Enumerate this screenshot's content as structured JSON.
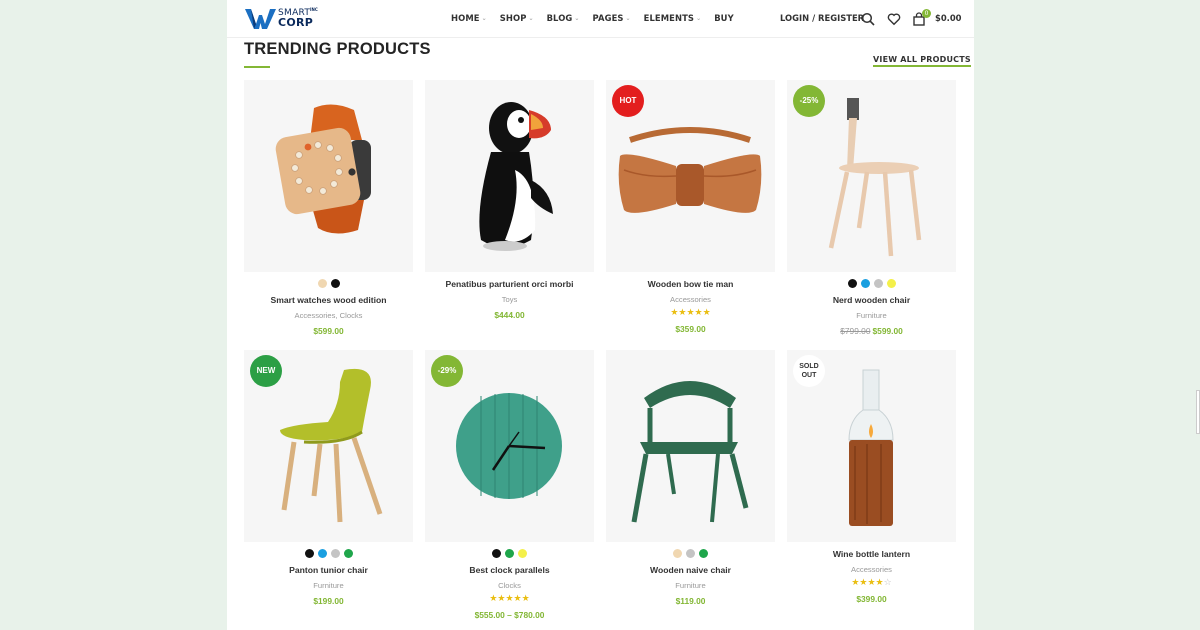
{
  "header": {
    "logo_line1": "SMART",
    "logo_line2": "CORP",
    "logo_mark": "INC",
    "nav": [
      {
        "label": "HOME",
        "caret": true
      },
      {
        "label": "SHOP",
        "caret": true
      },
      {
        "label": "BLOG",
        "caret": true
      },
      {
        "label": "PAGES",
        "caret": true
      },
      {
        "label": "ELEMENTS",
        "caret": true
      },
      {
        "label": "BUY",
        "caret": false
      }
    ],
    "login_label": "LOGIN / REGISTER",
    "cart_count": "0",
    "cart_total": "$0.00"
  },
  "section": {
    "title": "TRENDING PRODUCTS",
    "view_all": "VIEW ALL PRODUCTS"
  },
  "colors": {
    "accent": "#83b735",
    "hot": "#e31e1e",
    "new": "#2c9f45",
    "rating": "#eabe12"
  },
  "products": [
    {
      "name": "Smart watches wood edition",
      "category": "Accessories, Clocks",
      "price": "$599.00",
      "old_price": "",
      "badge": "",
      "rating": 0,
      "swatches": [
        "#f0d7b1",
        "#111111"
      ],
      "image": "watch"
    },
    {
      "name": "Penatibus parturient orci morbi",
      "category": "Toys",
      "price": "$444.00",
      "old_price": "",
      "badge": "",
      "rating": 0,
      "swatches": [],
      "image": "puffin"
    },
    {
      "name": "Wooden bow tie man",
      "category": "Accessories",
      "price": "$359.00",
      "old_price": "",
      "badge": "HOT",
      "rating": 5,
      "swatches": [],
      "image": "bowtie"
    },
    {
      "name": "Nerd wooden chair",
      "category": "Furniture",
      "price": "$599.00",
      "old_price": "$799.00",
      "badge": "-25%",
      "rating": 0,
      "swatches": [
        "#111111",
        "#1a9fe0",
        "#c4c4c4",
        "#f4f04a"
      ],
      "image": "chair"
    },
    {
      "name": "Panton tunior chair",
      "category": "Furniture",
      "price": "$199.00",
      "old_price": "",
      "badge": "NEW",
      "rating": 0,
      "swatches": [
        "#111111",
        "#1a9fe0",
        "#c4c4c4",
        "#1fa64b"
      ],
      "image": "panton"
    },
    {
      "name": "Best clock parallels",
      "category": "Clocks",
      "price": "$555.00 – $780.00",
      "old_price": "",
      "badge": "-29%",
      "rating": 5,
      "swatches": [
        "#111111",
        "#1fa64b",
        "#f4f04a"
      ],
      "image": "clock"
    },
    {
      "name": "Wooden naive chair",
      "category": "Furniture",
      "price": "$119.00",
      "old_price": "",
      "badge": "",
      "rating": 0,
      "swatches": [
        "#f0d7b1",
        "#c4c4c4",
        "#1fa64b"
      ],
      "image": "armchair"
    },
    {
      "name": "Wine bottle lantern",
      "category": "Accessories",
      "price": "$399.00",
      "old_price": "",
      "badge": "SOLD OUT",
      "rating": 4,
      "swatches": [],
      "image": "lantern"
    }
  ]
}
